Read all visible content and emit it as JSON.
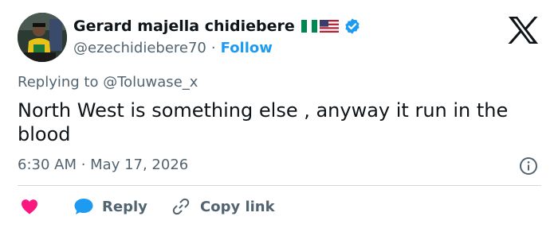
{
  "author": {
    "name": "Gerard majella chidiebere",
    "handle": "@ezechidiebere70",
    "separator": "·",
    "follow_label": "Follow"
  },
  "reply_context": {
    "text": "Replying to @Toluwase_x"
  },
  "tweet": {
    "text": "North West is something else , anyway it run in the blood",
    "timestamp": "6:30 AM · May 17, 2026"
  },
  "actions": {
    "reply_label": "Reply",
    "copy_link_label": "Copy link"
  },
  "icons": {
    "flags": [
      "nigeria-flag-icon",
      "us-flag-icon"
    ],
    "verified": "verified-badge-icon",
    "logo": "x-logo-icon",
    "info": "info-icon",
    "like": "heart-icon",
    "reply": "chat-bubble-icon",
    "copy": "link-icon"
  },
  "colors": {
    "accent": "#1d9bf0",
    "text": "#0f1419",
    "secondary": "#536471",
    "like": "#f91880",
    "divider": "#cfd9de"
  }
}
